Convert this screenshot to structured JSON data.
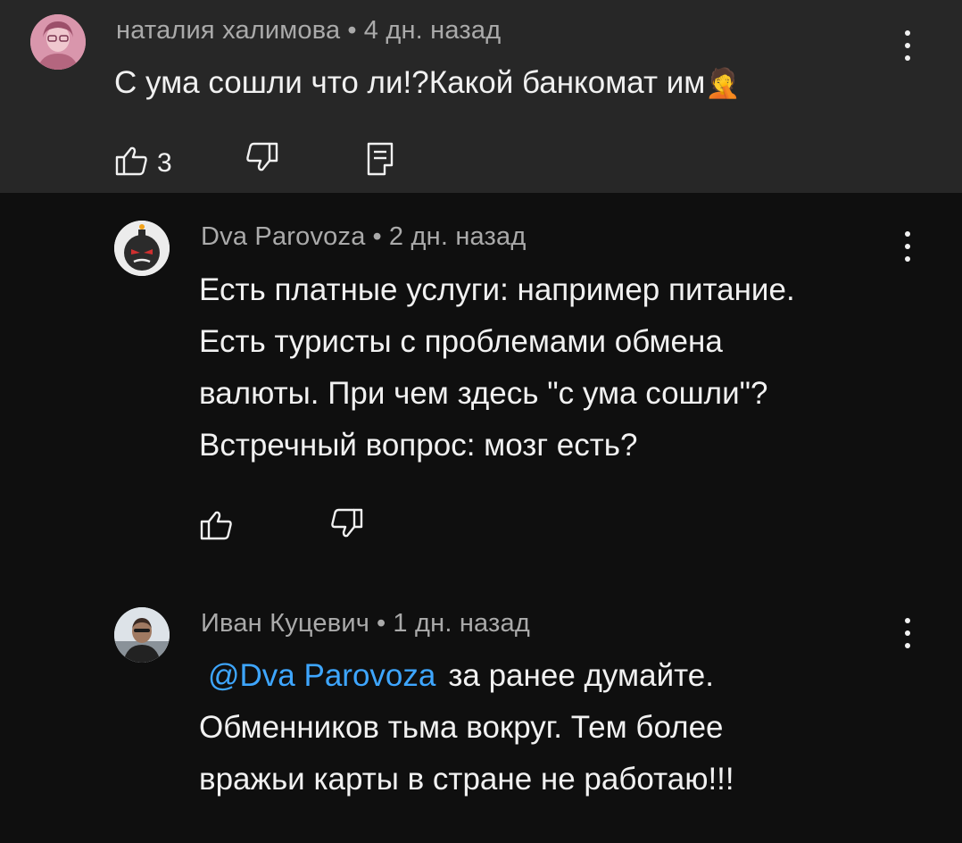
{
  "comments": [
    {
      "author": "наталия халимова",
      "separator": "•",
      "time": "4 дн. назад",
      "text": "С ума сошли что ли!?Какой банкомат им",
      "emoji": "🤦",
      "like_count": "3",
      "avatar_color": "#d98fa8"
    },
    {
      "author": "Dva Parovoza",
      "separator": "•",
      "time": "2 дн. назад",
      "text_lines": [
        "Есть платные услуги: например питание.",
        "Есть туристы с проблемами обмена",
        "валюты. При чем здесь \"с ума сошли\"?",
        "Встречный вопрос: мозг есть?"
      ],
      "avatar_color": "#e8e8e8"
    },
    {
      "author": "Иван Куцевич",
      "separator": "•",
      "time": "1 дн. назад",
      "mention": "@Dva Parovoza",
      "text_lines": [
        "за ранее думайте.",
        "Обменников тьма вокруг. Тем более",
        "вражьи карты в стране не работаю!!!"
      ],
      "avatar_color": "#cfd6dc"
    }
  ],
  "colors": {
    "parent_bg": "#272727",
    "page_bg": "#0f0f0f",
    "text": "#f1f1f1",
    "meta": "#aaaaaa",
    "link": "#3ea6ff"
  },
  "icons": [
    "like-icon",
    "dislike-icon",
    "reply-icon",
    "more-vert-icon"
  ]
}
